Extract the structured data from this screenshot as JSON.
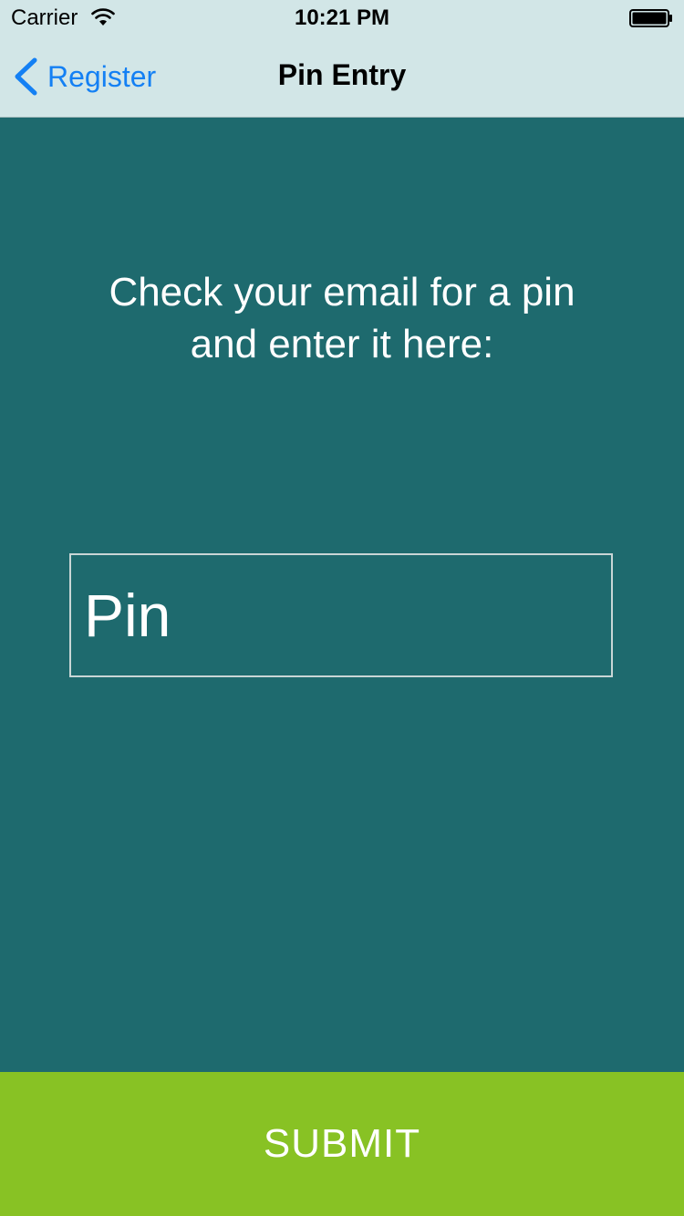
{
  "status_bar": {
    "carrier": "Carrier",
    "time": "10:21 PM"
  },
  "nav": {
    "back_label": "Register",
    "title": "Pin Entry"
  },
  "content": {
    "instruction": "Check your email for a pin and enter it here:",
    "pin_field": {
      "placeholder": "Pin",
      "value": ""
    }
  },
  "actions": {
    "submit_label": "SUBMIT"
  },
  "colors": {
    "background": "#1e6a6e",
    "nav_background": "#d2e6e7",
    "link": "#1480f4",
    "submit": "#88c224",
    "text_on_dark": "#ffffff"
  },
  "icons": {
    "wifi": "wifi-icon",
    "battery": "battery-icon",
    "back": "chevron-left-icon"
  }
}
